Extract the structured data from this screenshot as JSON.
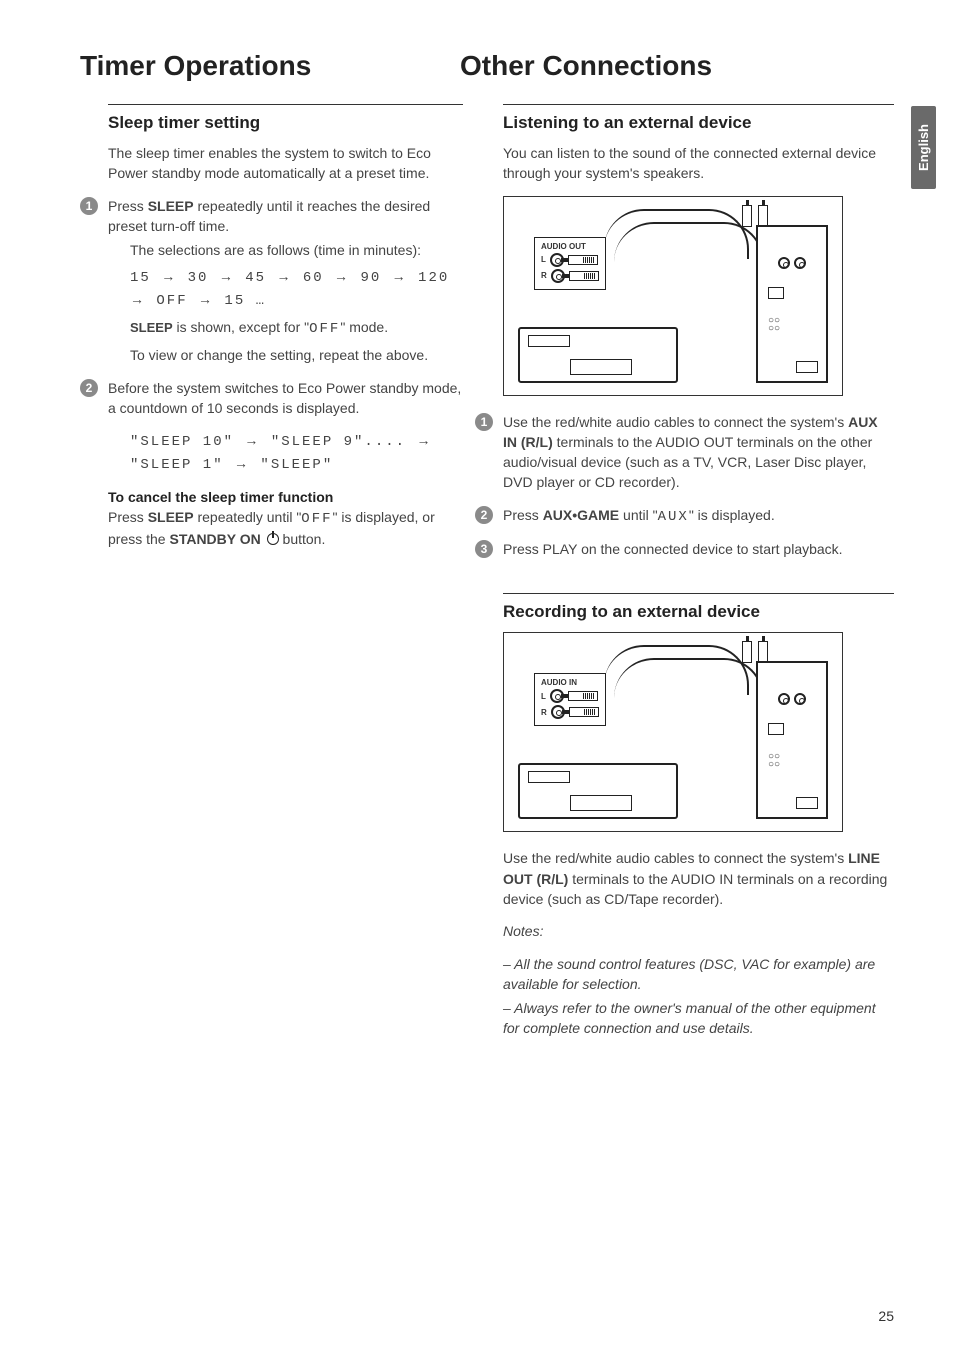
{
  "lang_tab": "English",
  "page_number": "25",
  "headings": {
    "left": "Timer Operations",
    "right": "Other Connections"
  },
  "left_col": {
    "section_title": "Sleep timer setting",
    "intro": "The sleep timer enables the system to switch to Eco Power standby mode automatically at a preset time.",
    "step1_a": "Press ",
    "step1_bold": "SLEEP",
    "step1_b": " repeatedly until it reaches the desired preset turn-off time.",
    "step1_sub": "The selections are as follows (time in minutes):",
    "sequence": "15 ™ 30 ™ 45 ™ 60 ™ 90 ™ 120 ™ OFF ™ 15 …",
    "sleep_note_a": "SLEEP",
    "sleep_note_b": " is shown, except for \"",
    "sleep_note_seg": "OFF",
    "sleep_note_c": "\" mode.",
    "sleep_view": "To view or change the setting, repeat the above.",
    "step2": "Before the system switches to Eco Power standby mode, a countdown of 10 seconds is displayed.",
    "countdown": "\"SLEEP 10\" ™ \"SLEEP 9\".... ™ \"SLEEP 1\" ™ \"SLEEP\"",
    "cancel_title": "To cancel the sleep timer function",
    "cancel_a": "Press ",
    "cancel_bold1": "SLEEP",
    "cancel_b": " repeatedly until \"",
    "cancel_seg": "OFF",
    "cancel_c": "\" is displayed, or press the ",
    "cancel_bold2": "STANDBY ON",
    "cancel_d": " button."
  },
  "right_col": {
    "sec1_title": "Listening to an external device",
    "sec1_intro": "You can listen to the sound of the connected external device through your system's speakers.",
    "diagram1_label": "AUDIO OUT",
    "l_label": "L",
    "r_label": "R",
    "s1_step1_a": "Use the red/white audio cables to connect the system's ",
    "s1_step1_bold": "AUX IN (R/L)",
    "s1_step1_b": " terminals to the AUDIO OUT terminals on the other audio/visual device (such as a TV, VCR, Laser Disc player, DVD player or CD recorder).",
    "s1_step2_a": "Press ",
    "s1_step2_bold": "AUX•GAME",
    "s1_step2_b": " until \"",
    "s1_step2_seg": "AUX",
    "s1_step2_c": "\" is displayed.",
    "s1_step3": "Press PLAY on the connected device to start playback.",
    "sec2_title": "Recording to an external device",
    "diagram2_label": "AUDIO IN",
    "sec2_para_a": "Use the red/white audio cables to connect the system's ",
    "sec2_para_bold": "LINE OUT (R/L)",
    "sec2_para_b": " terminals to the AUDIO IN terminals on a recording device (such as CD/Tape recorder).",
    "notes_label": "Notes:",
    "note1": "–  All the sound control features (DSC, VAC for example) are available for selection.",
    "note2": "–  Always refer to the owner's manual of the other equipment for complete connection and use details."
  }
}
